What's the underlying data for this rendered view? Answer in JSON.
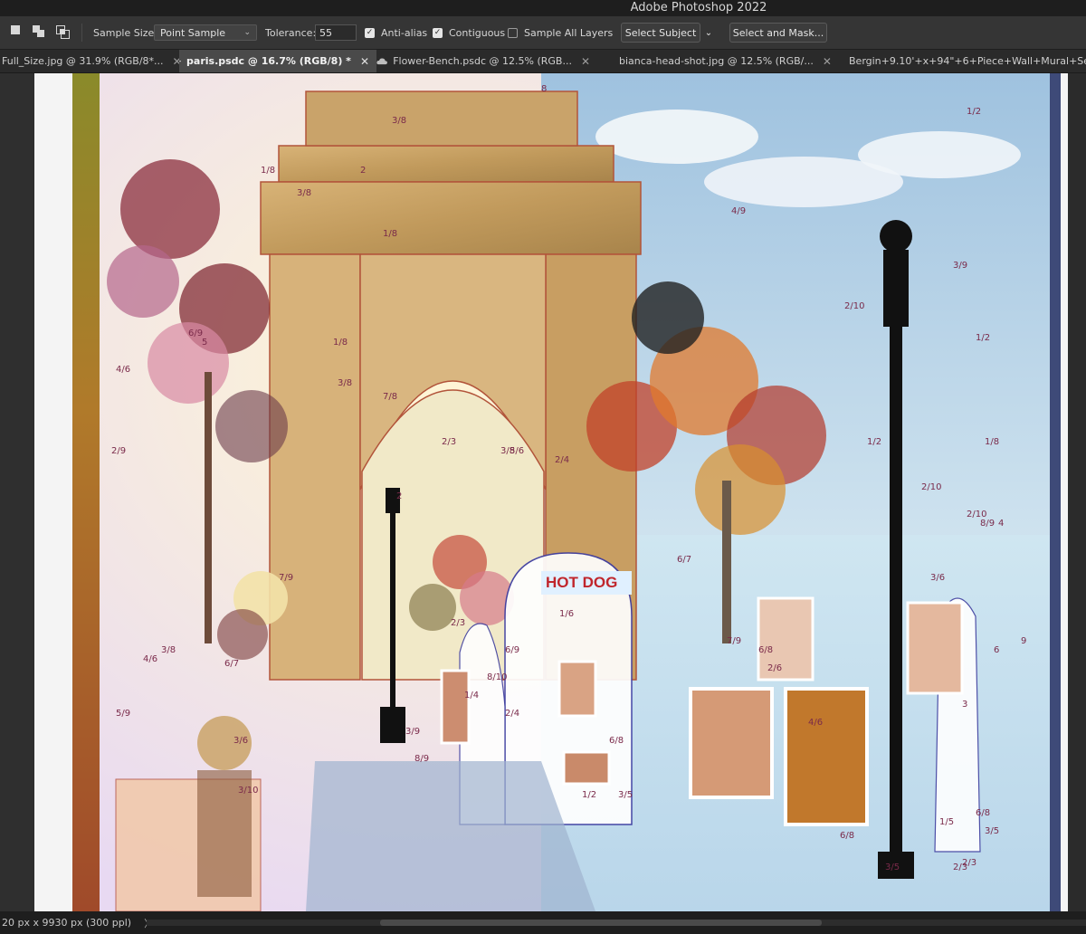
{
  "app": {
    "window_title": "Adobe Photoshop 2022"
  },
  "options_bar": {
    "sample_size_label": "Sample Size:",
    "sample_size_value": "Point Sample",
    "tolerance_label": "Tolerance:",
    "tolerance_value": "55",
    "anti_alias_label": "Anti-alias",
    "anti_alias_checked": true,
    "contiguous_label": "Contiguous",
    "contiguous_checked": true,
    "sample_all_layers_label": "Sample All Layers",
    "sample_all_layers_checked": false,
    "select_subject_label": "Select Subject",
    "select_and_mask_label": "Select and Mask..."
  },
  "tabs": [
    {
      "label": "Full_Size.jpg @ 31.9% (RGB/8*...",
      "cloud": false,
      "active": false
    },
    {
      "label": "paris.psdc @ 16.7% (RGB/8) *",
      "cloud": true,
      "active": true
    },
    {
      "label": "Flower-Bench.psdc @ 12.5% (RGB...",
      "cloud": true,
      "active": false
    },
    {
      "label": "bianca-head-shot.jpg @ 12.5% (RGB/...",
      "cloud": false,
      "active": false
    },
    {
      "label": "Bergin+9.10'+x+94\"+6+Piece+Wall+Mural+Se",
      "cloud": false,
      "active": false
    }
  ],
  "canvas": {
    "sign_text": "HOT DOG",
    "paint_labels": [
      "1/2",
      "1/8",
      "3/8",
      "2",
      "3/8",
      "8",
      "1/8",
      "3/8",
      "2",
      "4/9",
      "2/10",
      "3/9",
      "6/9",
      "5",
      "4/6",
      "2/9",
      "7/8",
      "1/8",
      "3/8",
      "2/3",
      "1/2",
      "2/10",
      "2/3",
      "6/7",
      "3/6",
      "6/7",
      "3/8",
      "4/6",
      "5/9",
      "7/9",
      "8/10",
      "1/4",
      "2/4",
      "1/6",
      "6/8",
      "3/5",
      "3/9",
      "8/9",
      "3/10",
      "6/8",
      "2/6",
      "4/6",
      "6/8",
      "3/5",
      "2/3",
      "1/5",
      "3/5",
      "6/8",
      "2/3",
      "1/2",
      "3",
      "6",
      "9",
      "4",
      "8/9",
      "1/8",
      "2/10",
      "1/2",
      "2/4",
      "5/6",
      "7/9",
      "6/9",
      "3/6"
    ]
  },
  "status": {
    "doc_size": "20 px x 9930 px (300 ppl)",
    "arrow": "〉"
  }
}
